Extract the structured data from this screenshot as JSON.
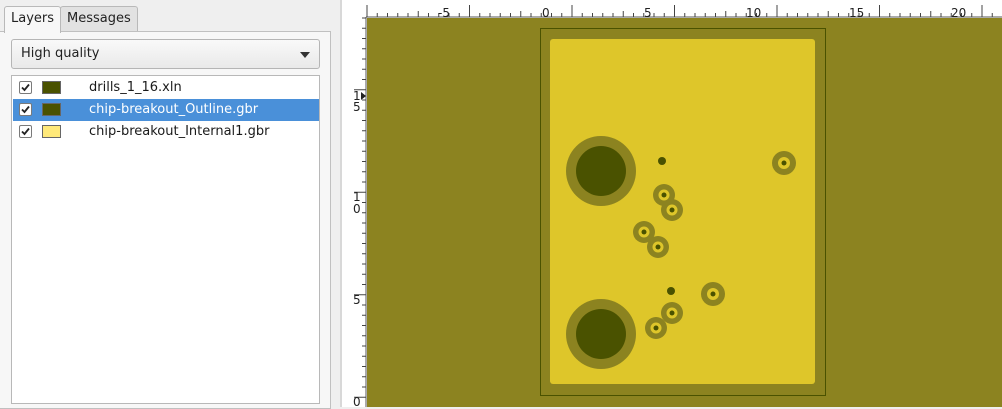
{
  "tabs": [
    {
      "label": "Layers",
      "active": true
    },
    {
      "label": "Messages",
      "active": false
    }
  ],
  "render_mode": {
    "selected": "High quality"
  },
  "layers": [
    {
      "name": "drills_1_16.xln",
      "visible": true,
      "color": "#4a5200",
      "selected": false
    },
    {
      "name": "chip-breakout_Outline.gbr",
      "visible": true,
      "color": "#4a5200",
      "selected": true
    },
    {
      "name": "chip-breakout_Internal1.gbr",
      "visible": true,
      "color": "#ffe97a",
      "selected": false
    }
  ],
  "ruler": {
    "top_labels": [
      "-5",
      "0",
      "5",
      "10",
      "15",
      "20"
    ],
    "left_labels": [
      "1",
      "5",
      "1",
      "0",
      "5",
      "0"
    ]
  },
  "colors": {
    "canvas_bg": "#8c8320",
    "board_fill": "#dec62a",
    "pad_ring": "#8c8320",
    "drill": "#4a5200",
    "selection": "#4a90d9"
  }
}
